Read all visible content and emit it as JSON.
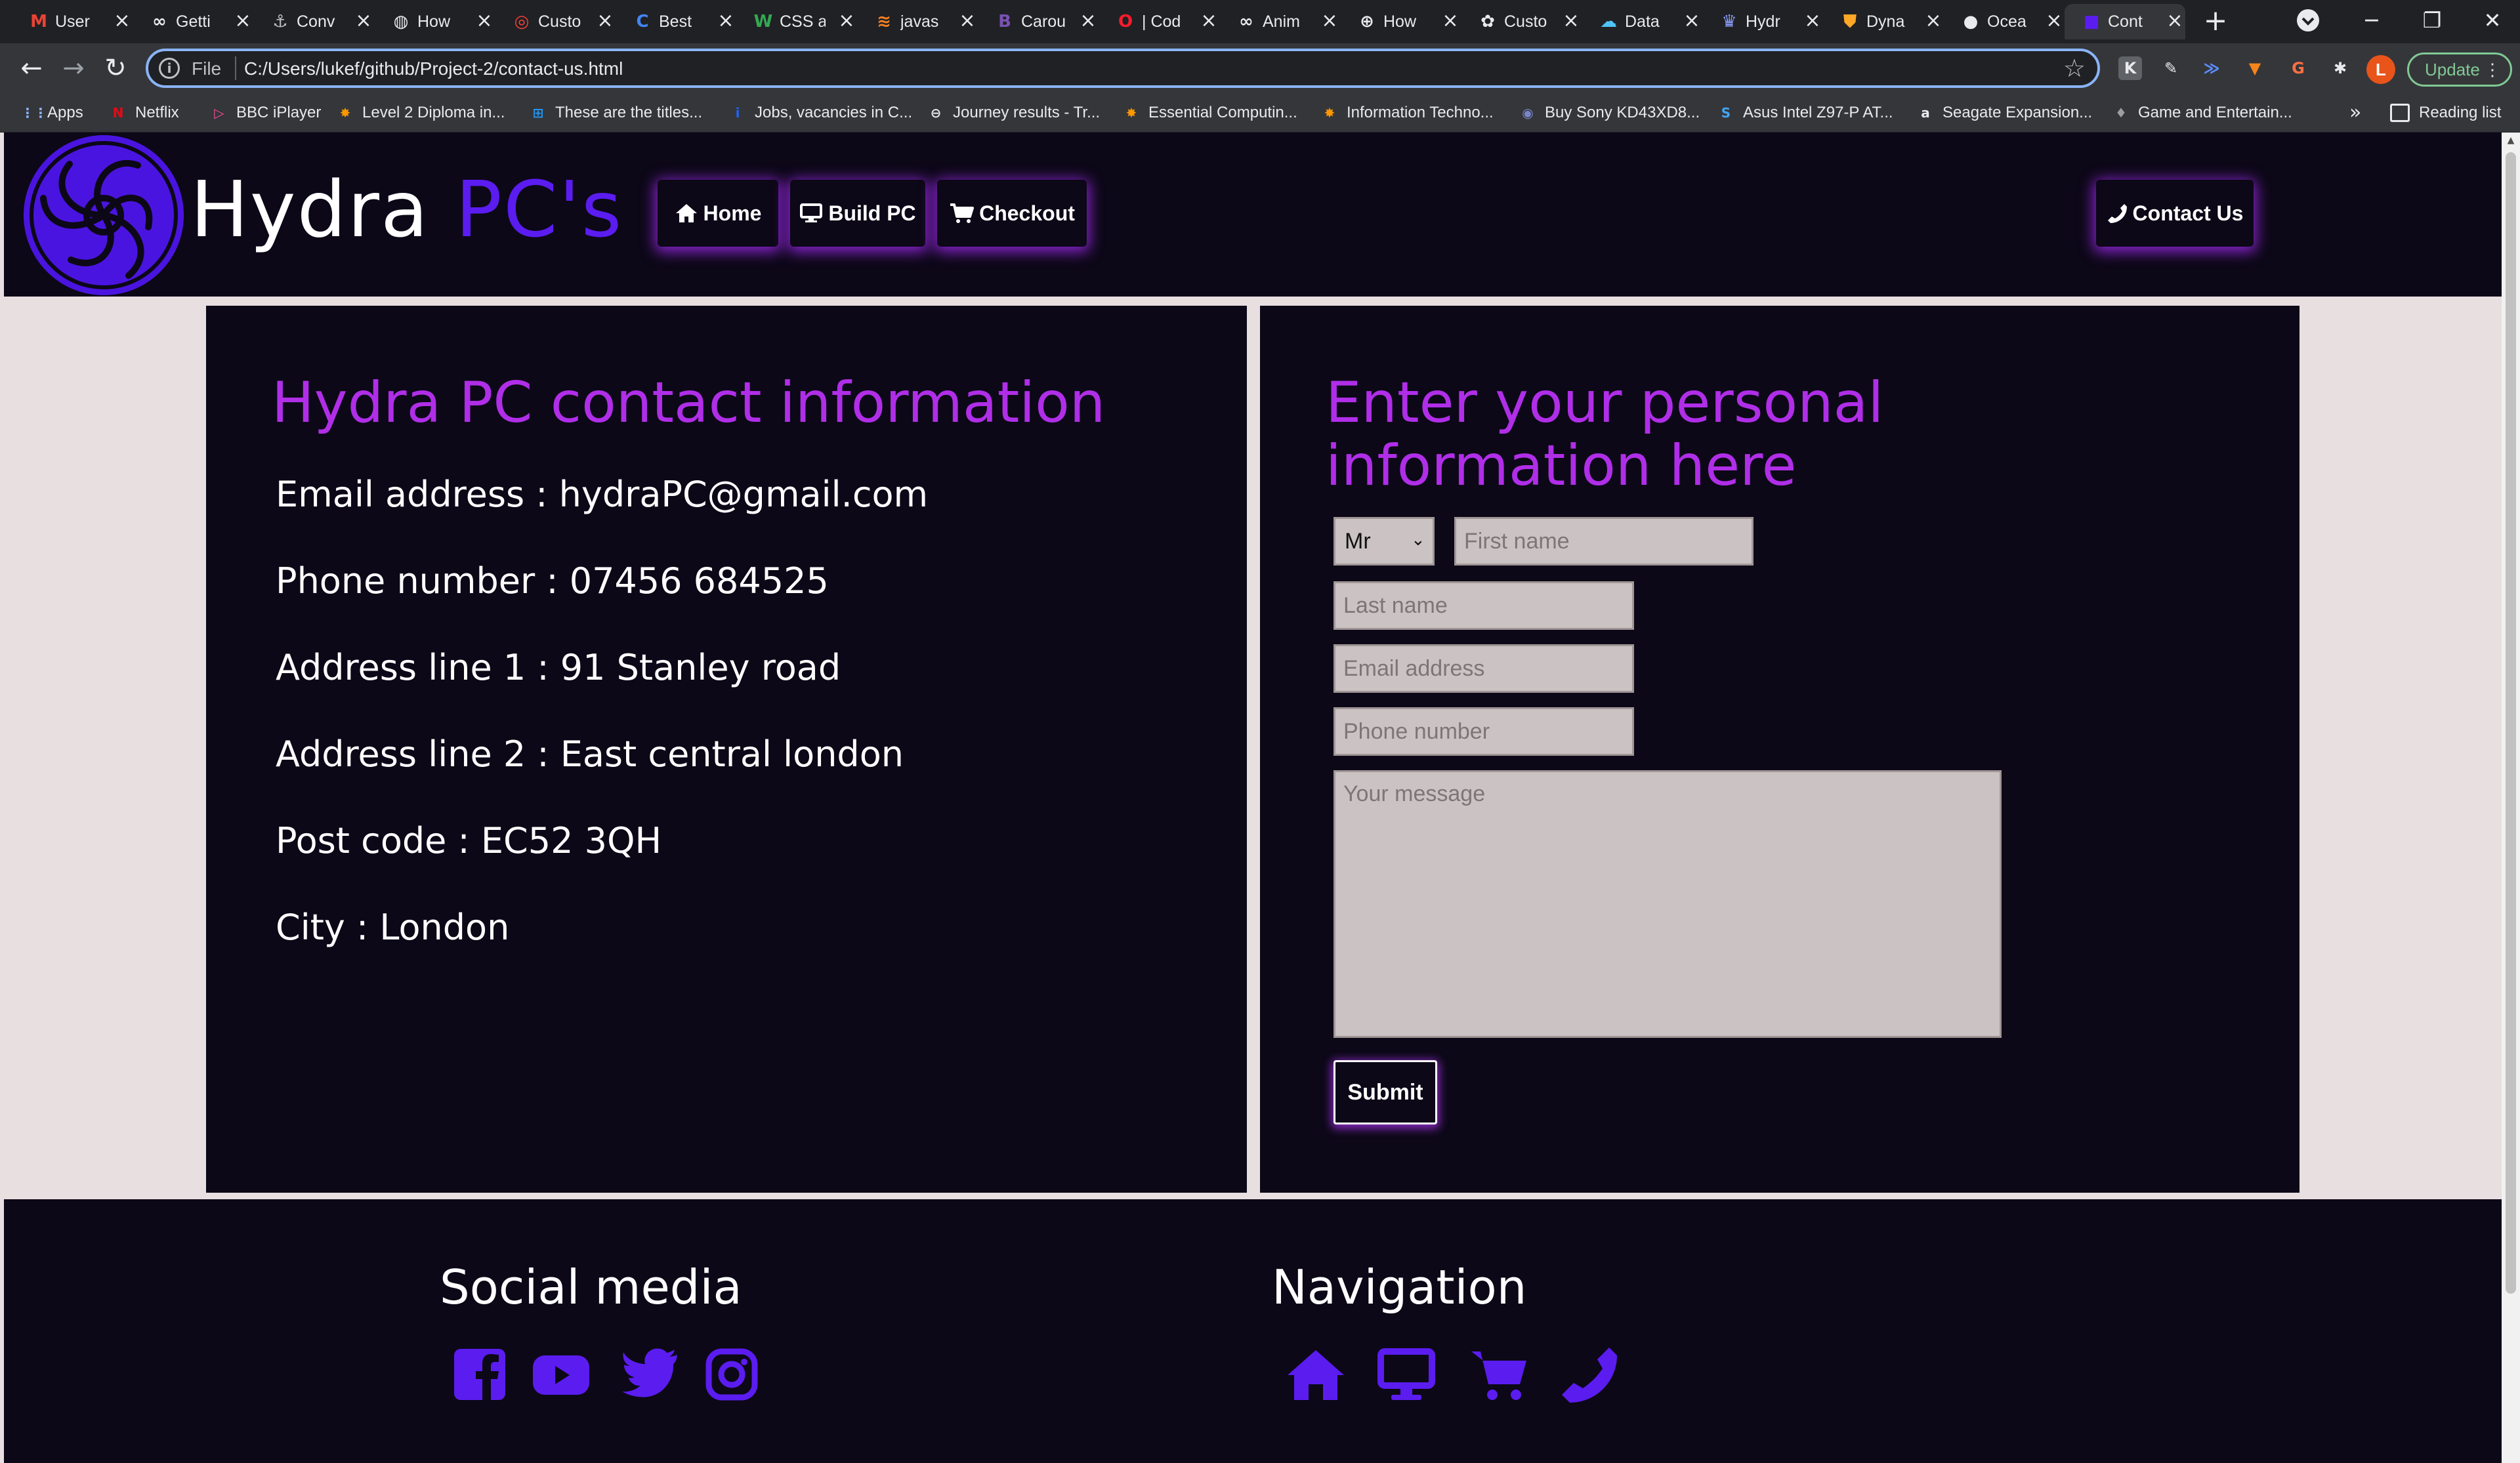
{
  "browser": {
    "tabs": [
      {
        "title": "User",
        "favicon": "gmail-icon",
        "glyph": "M",
        "color": "#ea4335"
      },
      {
        "title": "Getti",
        "favicon": "infinity-icon",
        "glyph": "∞",
        "color": "#e8eaed"
      },
      {
        "title": "Conv",
        "favicon": "anchor-icon",
        "glyph": "⚓",
        "color": "#bdc1c6"
      },
      {
        "title": "How",
        "favicon": "generic-site-icon",
        "glyph": "◍",
        "color": "#e8eaed"
      },
      {
        "title": "Custo",
        "favicon": "rdo-icon",
        "glyph": "◎",
        "color": "#f44336"
      },
      {
        "title": "Best",
        "favicon": "c-icon",
        "glyph": "C",
        "color": "#4285f4"
      },
      {
        "title": "CSS a",
        "favicon": "w-icon",
        "glyph": "W",
        "color": "#34a853"
      },
      {
        "title": "javas",
        "favicon": "stackoverflow-icon",
        "glyph": "≋",
        "color": "#f48024"
      },
      {
        "title": "Carou",
        "favicon": "bootstrap-icon",
        "glyph": "B",
        "color": "#7952b3"
      },
      {
        "title": "| Cod",
        "favicon": "opera-icon",
        "glyph": "O",
        "color": "#ff1b2d"
      },
      {
        "title": "Anim",
        "favicon": "infinity-icon",
        "glyph": "∞",
        "color": "#e8eaed"
      },
      {
        "title": "How",
        "favicon": "globe-icon",
        "glyph": "⊕",
        "color": "#e8eaed"
      },
      {
        "title": "Custo",
        "favicon": "chatgpt-icon",
        "glyph": "✿",
        "color": "#e8eaed"
      },
      {
        "title": "Data",
        "favicon": "database-icon",
        "glyph": "☁",
        "color": "#4fc3f7"
      },
      {
        "title": "Hydr",
        "favicon": "hydra-icon",
        "glyph": "♛",
        "color": "#8c9eff"
      },
      {
        "title": "Dyna",
        "favicon": "shield-icon",
        "glyph": "⛊",
        "color": "#ffa726"
      },
      {
        "title": "Ocea",
        "favicon": "github-icon",
        "glyph": "●",
        "color": "#e8eaed"
      },
      {
        "title": "Cont",
        "favicon": "hydra-page-icon",
        "glyph": "■",
        "color": "#5b1cf0"
      }
    ],
    "new_tab": "+",
    "window": {
      "minimize": "─",
      "restore": "❐",
      "close": "✕"
    },
    "address": {
      "scheme_label": "File",
      "url": "C:/Users/lukef/github/Project-2/contact-us.html"
    },
    "profile_initial": "L",
    "update_label": "Update",
    "bookmarks": [
      {
        "label": "Apps",
        "icon": "apps-grid-icon",
        "glyph": "⋮⋮",
        "color": "#8ab4f8"
      },
      {
        "label": "Netflix",
        "icon": "netflix-icon",
        "glyph": "N",
        "color": "#e50914"
      },
      {
        "label": "BBC iPlayer",
        "icon": "iplayer-icon",
        "glyph": "▷",
        "color": "#f54997"
      },
      {
        "label": "Level 2 Diploma in...",
        "icon": "star-badge-icon",
        "glyph": "✸",
        "color": "#ff9800"
      },
      {
        "label": "These are the titles...",
        "icon": "windows-icon",
        "glyph": "⊞",
        "color": "#2196f3"
      },
      {
        "label": "Jobs, vacancies in C...",
        "icon": "indeed-icon",
        "glyph": "i",
        "color": "#2164f3"
      },
      {
        "label": "Journey results - Tr...",
        "icon": "tfl-icon",
        "glyph": "⊖",
        "color": "#e8eaed"
      },
      {
        "label": "Essential Computin...",
        "icon": "star-badge-icon",
        "glyph": "✸",
        "color": "#ff9800"
      },
      {
        "label": "Information Techno...",
        "icon": "star-badge-icon",
        "glyph": "✸",
        "color": "#ff9800"
      },
      {
        "label": "Buy Sony KD43XD8...",
        "icon": "ebuyer-icon",
        "glyph": "◉",
        "color": "#7986cb"
      },
      {
        "label": "Asus Intel Z97-P AT...",
        "icon": "scan-icon",
        "glyph": "S",
        "color": "#42a5f5"
      },
      {
        "label": "Seagate Expansion...",
        "icon": "amazon-icon",
        "glyph": "a",
        "color": "#e8eaed"
      },
      {
        "label": "Game and Entertain...",
        "icon": "shield-icon",
        "glyph": "♦",
        "color": "#9e9e9e"
      }
    ],
    "bookmarks_more": "»",
    "reading_list": "Reading list"
  },
  "site": {
    "brand": {
      "part1": "Hydra ",
      "part2": "PC's"
    },
    "accent_color": "#5b1cf0",
    "heading_color": "#b02ee8",
    "nav": [
      {
        "label": "Home",
        "icon": "home-icon"
      },
      {
        "label": "Build PC",
        "icon": "monitor-icon"
      },
      {
        "label": "Checkout",
        "icon": "cart-icon"
      },
      {
        "label": "Contact Us",
        "icon": "phone-icon"
      }
    ]
  },
  "contact_info": {
    "title": "Hydra PC contact information",
    "lines": [
      "Email address : hydraPC@gmail.com",
      "Phone number : 07456 684525",
      "Address line 1 : 91 Stanley road",
      "Address line 2 : East central london",
      "Post code : EC52 3QH",
      "City : London"
    ]
  },
  "form": {
    "title": "Enter your personal information here",
    "title_selected": "Mr",
    "title_options": [
      "Mr"
    ],
    "first_name_placeholder": "First name",
    "last_name_placeholder": "Last name",
    "email_placeholder": "Email address",
    "phone_placeholder": "Phone number",
    "message_placeholder": "Your message",
    "submit_label": "Submit"
  },
  "footer": {
    "social_title": "Social media",
    "social_icons": [
      "facebook-icon",
      "youtube-icon",
      "twitter-icon",
      "instagram-icon"
    ],
    "nav_title": "Navigation",
    "nav_icons": [
      "home-icon",
      "monitor-icon",
      "cart-icon",
      "phone-icon"
    ]
  }
}
